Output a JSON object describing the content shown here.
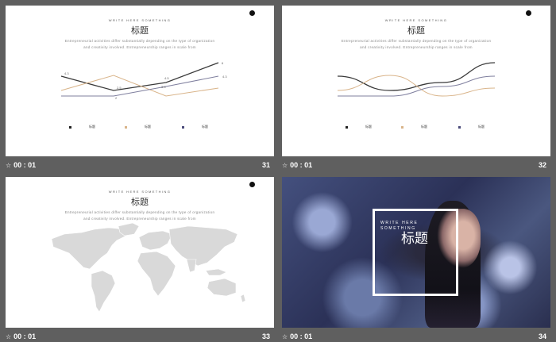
{
  "slides": [
    {
      "index": "31",
      "timer": "00 : 01",
      "kicker": "WRITE HERE SOMETHING",
      "title": "标题",
      "body_line1": "Entrepreneurial activities differ substantially depending on the type of organization",
      "body_line2": "and creativity involved. Entrepreneurship ranges in scale from",
      "legend": [
        "标题",
        "标题",
        "标题"
      ],
      "point_labels": [
        "4.3",
        "2.5",
        "4.5",
        "2",
        "3.5",
        "6",
        "4.3"
      ],
      "chart_data": {
        "type": "line",
        "categories": [
          "",
          "",
          "",
          ""
        ],
        "series": [
          {
            "values": [
              4.3,
              2.5,
              3.5,
              6
            ]
          },
          {
            "values": [
              2.5,
              4.4,
              1.8,
              2.8
            ]
          },
          {
            "values": [
              1.8,
              1.8,
              3.0,
              4.3
            ]
          }
        ],
        "ylim": [
          0,
          7
        ]
      }
    },
    {
      "index": "32",
      "timer": "00 : 01",
      "kicker": "WRITE HERE SOMETHING",
      "title": "标题",
      "body_line1": "Entrepreneurial activities differ substantially depending on the type of organization",
      "body_line2": "and creativity involved. Entrepreneurship ranges in scale from",
      "legend": [
        "标题",
        "标题",
        "标题"
      ],
      "chart_data": {
        "type": "line",
        "categories": [
          "",
          "",
          "",
          ""
        ],
        "series": [
          {
            "values": [
              4.3,
              2.5,
              3.5,
              6
            ]
          },
          {
            "values": [
              2.5,
              4.4,
              1.8,
              2.8
            ]
          },
          {
            "values": [
              1.8,
              1.8,
              3.0,
              4.3
            ]
          }
        ],
        "ylim": [
          0,
          7
        ]
      }
    },
    {
      "index": "33",
      "timer": "00 : 01",
      "kicker": "WRITE HERE SOMETHING",
      "title": "标题",
      "body_line1": "Entrepreneurial activities differ substantially depending on the type of organization",
      "body_line2": "and creativity involved. Entrepreneurship ranges in scale from"
    },
    {
      "index": "34",
      "timer": "00 : 01",
      "kicker": "WRITE HERE SOMETHING",
      "title": "标题"
    }
  ],
  "colors": {
    "background": "#5f5f5f",
    "series": [
      "#3a3a3a",
      "#d9b48a",
      "#7f7f9e"
    ],
    "map": "#d9d9d9"
  },
  "icons": {
    "slide_transition": "star-icon"
  }
}
